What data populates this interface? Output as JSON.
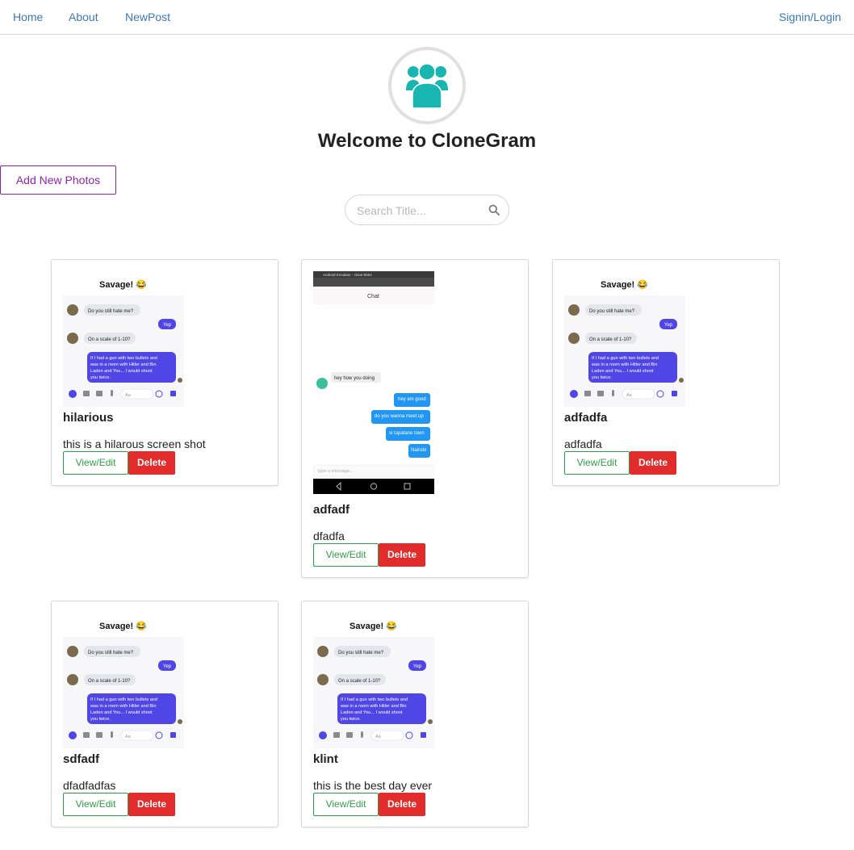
{
  "nav": {
    "home": "Home",
    "about": "About",
    "newpost": "NewPost",
    "signin": "Signin/Login"
  },
  "hero": {
    "logo_icon": "users-group-icon",
    "title": "Welcome to CloneGram",
    "add_button": "Add New Photos"
  },
  "search": {
    "placeholder": "Search Title...",
    "icon": "search-icon"
  },
  "colors": {
    "link": "#3b78b8",
    "accent_purple": "#8e24aa",
    "logo_teal": "#19b5b1",
    "view_green": "#2e9e46",
    "delete_red": "#e22b2b"
  },
  "screenshot_text": {
    "savage": "Savage! 😂",
    "msg1": "Do you still hate me?",
    "yep": "Yep",
    "msg2": "On a scale of 1-10?",
    "msg3": "If I had a gun with two bullets and was in a room with Hitler and Bin Laden and You... I would shoot you twice.",
    "input": "Aa",
    "emulator_title": "Android Emulator - clone:5554",
    "chat": "Chat",
    "hey": "hey how you doing",
    "r1": "hey am good",
    "r2": "do you wanna meet up",
    "r3": "si tupatane town",
    "r4": "Nairobi",
    "type": "type a message..."
  },
  "posts": [
    {
      "title": "hilarious",
      "description": "this is a hilarous screen shot",
      "view_label": "View/Edit",
      "delete_label": "Delete",
      "image": "savage-chat"
    },
    {
      "title": "adfadf",
      "description": "dfadfa",
      "view_label": "View/Edit",
      "delete_label": "Delete",
      "image": "android-chat"
    },
    {
      "title": "adfadfa",
      "description": "adfadfa",
      "view_label": "View/Edit",
      "delete_label": "Delete",
      "image": "savage-chat"
    },
    {
      "title": "sdfadf",
      "description": "dfadfadfas",
      "view_label": "View/Edit",
      "delete_label": "Delete",
      "image": "savage-chat"
    },
    {
      "title": "klint",
      "description": "this is the best day ever",
      "view_label": "View/Edit",
      "delete_label": "Delete",
      "image": "savage-chat"
    }
  ]
}
